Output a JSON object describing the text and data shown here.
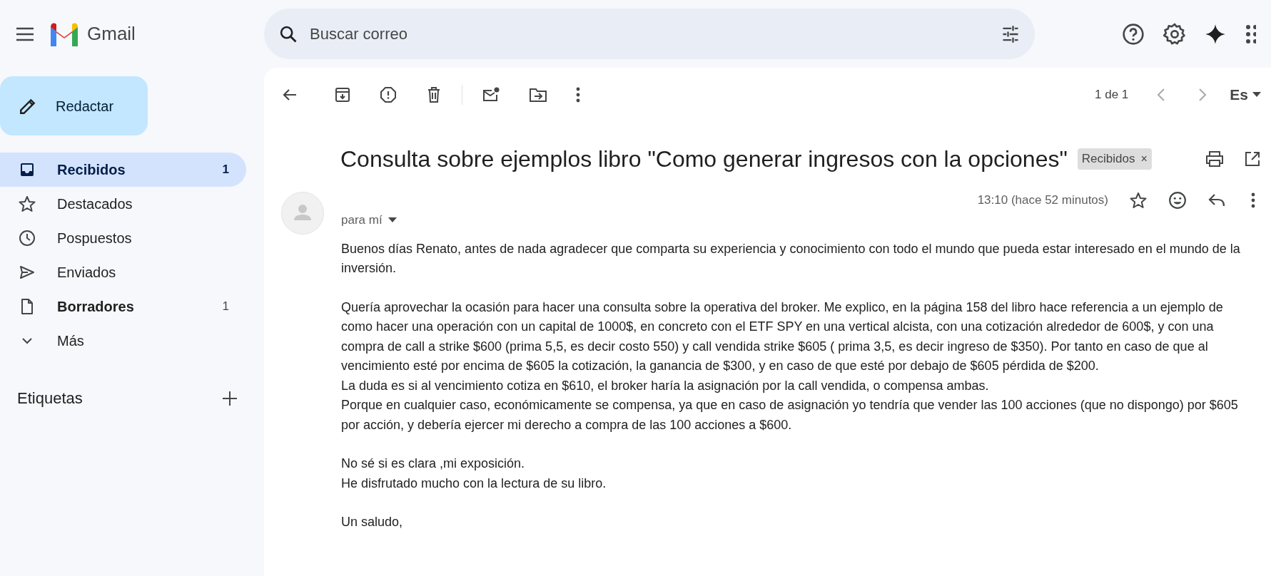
{
  "app": {
    "name": "Gmail"
  },
  "search": {
    "placeholder": "Buscar correo"
  },
  "compose": {
    "label": "Redactar"
  },
  "sidebar": {
    "items": [
      {
        "label": "Recibidos",
        "count": "1",
        "selected": true,
        "bold": true
      },
      {
        "label": "Destacados",
        "selected": false,
        "bold": false
      },
      {
        "label": "Pospuestos",
        "selected": false,
        "bold": false
      },
      {
        "label": "Enviados",
        "selected": false,
        "bold": false
      },
      {
        "label": "Borradores",
        "count": "1",
        "selected": false,
        "bold": true
      },
      {
        "label": "Más",
        "selected": false,
        "bold": false
      }
    ],
    "labels_heading": "Etiquetas"
  },
  "pager": {
    "text": "1 de 1",
    "input_tool": "Es"
  },
  "message": {
    "subject": "Consulta sobre ejemplos libro \"Como generar ingresos con la opciones\"",
    "label_chip": "Recibidos",
    "label_chip_remove": "×",
    "time": "13:10 (hace 52 minutos)",
    "recipient": "para mí",
    "paragraphs": [
      [
        "Buenos días Renato, antes de nada agradecer que comparta su experiencia y conocimiento con todo el mundo que pueda estar interesado en el mundo de la inversión."
      ],
      [
        "Quería aprovechar la ocasión para hacer una consulta sobre la operativa del broker. Me explico, en la página 158 del libro hace referencia a un ejemplo de como hacer una operación con un capital de 1000$, en concreto con el ETF SPY en una vertical alcista, con una cotización alrededor de 600$, y con una compra de call a strike $600 (prima 5,5, es decir costo 550) y call vendida strike $605 ( prima 3,5, es decir ingreso de $350). Por tanto en caso de que al vencimiento esté por encima de $605 la cotización, la ganancia de $300, y en caso de que esté por debajo de $605 pérdida de $200.",
        "La duda es si al vencimiento cotiza en $610, el broker haría la asignación por la call vendida, o compensa ambas.",
        "Porque en cualquier caso, económicamente se compensa, ya que en caso de asignación yo tendría que vender las 100 acciones  (que no dispongo) por $605 por acción, y debería ejercer mi derecho a compra de las 100 acciones a $600."
      ],
      [
        "No sé si es clara ,mi exposición.",
        "He disfrutado mucho con la lectura de su libro."
      ],
      [
        "Un saludo,"
      ]
    ]
  }
}
